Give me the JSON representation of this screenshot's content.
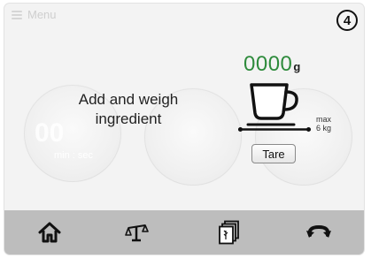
{
  "header": {
    "menu_label": "Menu",
    "step_number": "4"
  },
  "ghost": {
    "timer": "00",
    "timer_label": "min : sec"
  },
  "main": {
    "instruction_line1": "Add and weigh",
    "instruction_line2": "ingredient",
    "weight_value": "0000",
    "weight_unit": "g",
    "max_label": "max",
    "max_value": "6 kg",
    "tare_label": "Tare"
  },
  "colors": {
    "weight_green": "#2e8b3c",
    "navbar_bg": "#bdbdbd"
  },
  "navbar": {
    "items": [
      {
        "icon": "home-icon"
      },
      {
        "icon": "scale-icon"
      },
      {
        "icon": "recipe-cards-icon"
      },
      {
        "icon": "reverse-icon"
      }
    ]
  }
}
